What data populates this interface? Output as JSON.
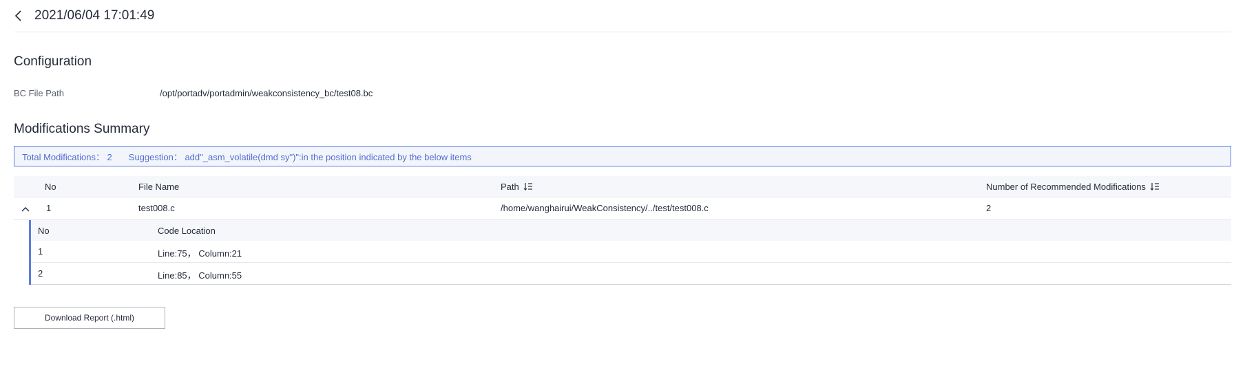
{
  "header": {
    "title": "2021/06/04 17:01:49"
  },
  "configuration": {
    "title": "Configuration",
    "bc_file_path_label": "BC File Path",
    "bc_file_path_value": "/opt/portadv/portadmin/weakconsistency_bc/test08.bc"
  },
  "summary": {
    "title": "Modifications Summary",
    "total": "Total Modifications： 2",
    "suggestion": "Suggestion： add\"_asm_volatile(dmd sy\")\":in the position indicated by the below items"
  },
  "table": {
    "columns": [
      "No",
      "File Name",
      "Path",
      "Number of Recommended Modifications"
    ],
    "rows": [
      {
        "no": "1",
        "file_name": "test008.c",
        "path": "/home/wanghairui/WeakConsistency/../test/test008.c",
        "count": "2"
      }
    ],
    "sub_columns": [
      "No",
      "Code Location"
    ],
    "sub_rows": [
      {
        "no": "1",
        "location": "Line:75， Column:21"
      },
      {
        "no": "2",
        "location": "Line:85， Column:55"
      }
    ]
  },
  "download_button": "Download Report (.html)",
  "icons": {
    "back": "chevron-left-icon",
    "sort": "sort-icon",
    "collapse": "chevron-up-icon"
  },
  "colors": {
    "accent": "#5e7ce0",
    "text": "#252b3a",
    "link": "#526ecc"
  }
}
